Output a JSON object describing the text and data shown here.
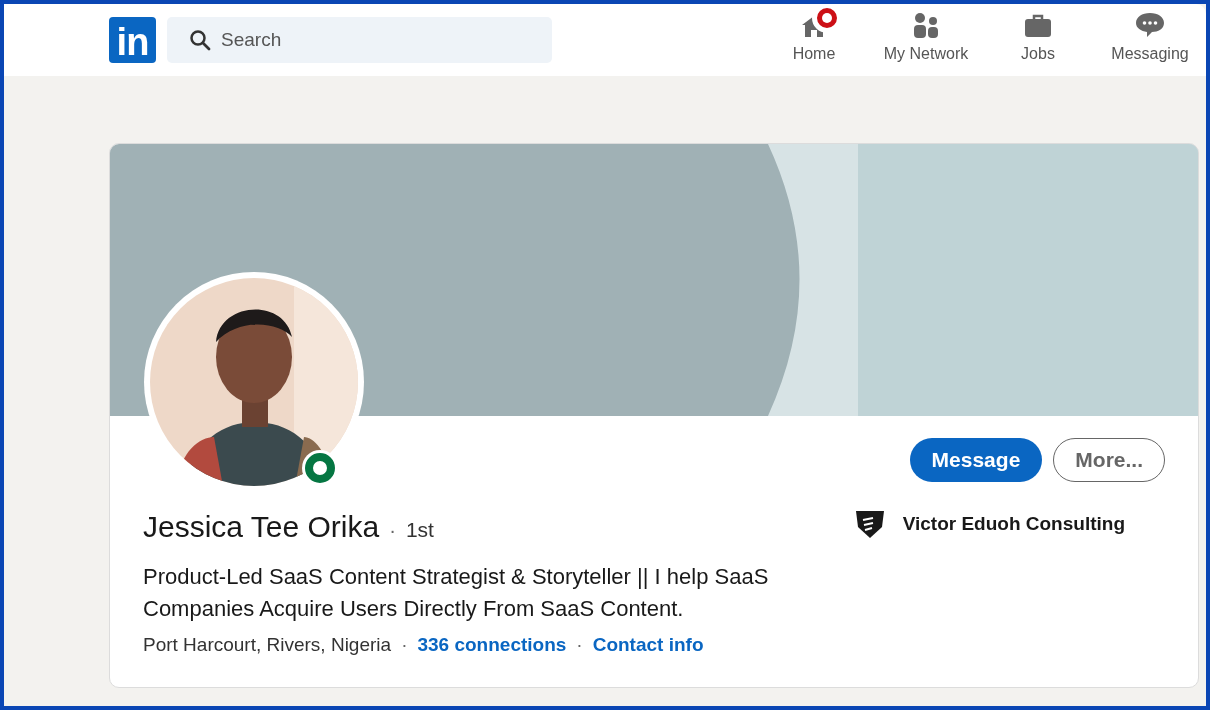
{
  "nav": {
    "logo": "in",
    "search": {
      "placeholder": "Search"
    },
    "items": [
      {
        "label": "Home",
        "kind": "home",
        "badge": true
      },
      {
        "label": "My Network",
        "kind": "network",
        "badge": false
      },
      {
        "label": "Jobs",
        "kind": "jobs",
        "badge": false
      },
      {
        "label": "Messaging",
        "kind": "messaging",
        "badge": false
      }
    ]
  },
  "profile": {
    "separator": "·",
    "online": true,
    "name": "Jessica Tee Orika",
    "degree": "1st",
    "headline": "Product-Led SaaS Content Strategist & Storyteller || I help SaaS Companies Acquire Users Directly From SaaS Content.",
    "location": "Port Harcourt, Rivers, Nigeria",
    "connections": "336 connections",
    "contact": "Contact info",
    "company": "Victor Eduoh Consulting",
    "buttons": [
      {
        "label": "Message",
        "kind": "primary"
      },
      {
        "label": "More...",
        "kind": "secondary"
      }
    ]
  }
}
